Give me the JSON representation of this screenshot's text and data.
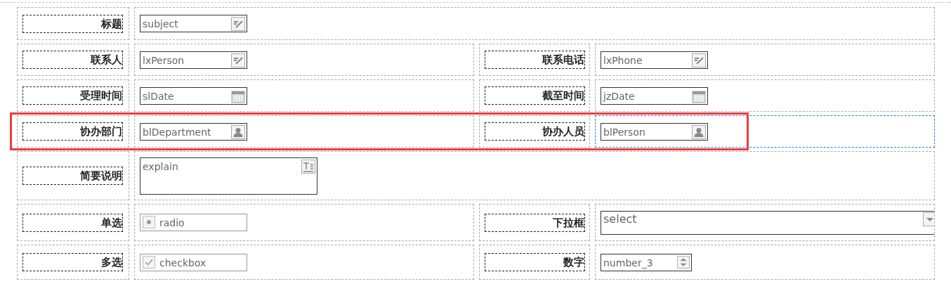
{
  "rows": [
    {
      "highlighted": false,
      "cells": [
        {
          "label": "标题",
          "field": {
            "kind": "text",
            "value": "subject",
            "selected": false
          },
          "wide": true
        }
      ]
    },
    {
      "highlighted": false,
      "cells": [
        {
          "label": "联系人",
          "field": {
            "kind": "text",
            "value": "lxPerson",
            "selected": false
          },
          "wide": false
        },
        {
          "label": "联系电话",
          "field": {
            "kind": "text",
            "value": "lxPhone",
            "selected": false
          },
          "wide": false
        }
      ]
    },
    {
      "highlighted": false,
      "cells": [
        {
          "label": "受理时间",
          "field": {
            "kind": "date",
            "value": "slDate",
            "selected": false
          },
          "wide": false
        },
        {
          "label": "截至时间",
          "field": {
            "kind": "date",
            "value": "jzDate",
            "selected": false
          },
          "wide": false
        }
      ]
    },
    {
      "highlighted": true,
      "cells": [
        {
          "label": "协办部门",
          "field": {
            "kind": "person",
            "value": "blDepartment",
            "selected": false
          },
          "wide": false
        },
        {
          "label": "协办人员",
          "field": {
            "kind": "person",
            "value": "blPerson",
            "selected": true
          },
          "wide": false
        }
      ]
    },
    {
      "highlighted": false,
      "cells": [
        {
          "label": "简要说明",
          "field": {
            "kind": "textarea",
            "value": "explain",
            "selected": false
          },
          "wide": true
        }
      ]
    },
    {
      "highlighted": false,
      "cells": [
        {
          "label": "单选",
          "field": {
            "kind": "radio",
            "value": "radio",
            "selected": false
          },
          "wide": false
        },
        {
          "label": "下拉框",
          "field": {
            "kind": "select",
            "value": "select",
            "selected": false
          },
          "wide": false
        }
      ]
    },
    {
      "highlighted": false,
      "cells": [
        {
          "label": "多选",
          "field": {
            "kind": "checkbox",
            "value": "checkbox",
            "selected": false
          },
          "wide": false
        },
        {
          "label": "数字",
          "field": {
            "kind": "number",
            "value": "number_3",
            "selected": false
          },
          "wide": false
        }
      ]
    }
  ]
}
